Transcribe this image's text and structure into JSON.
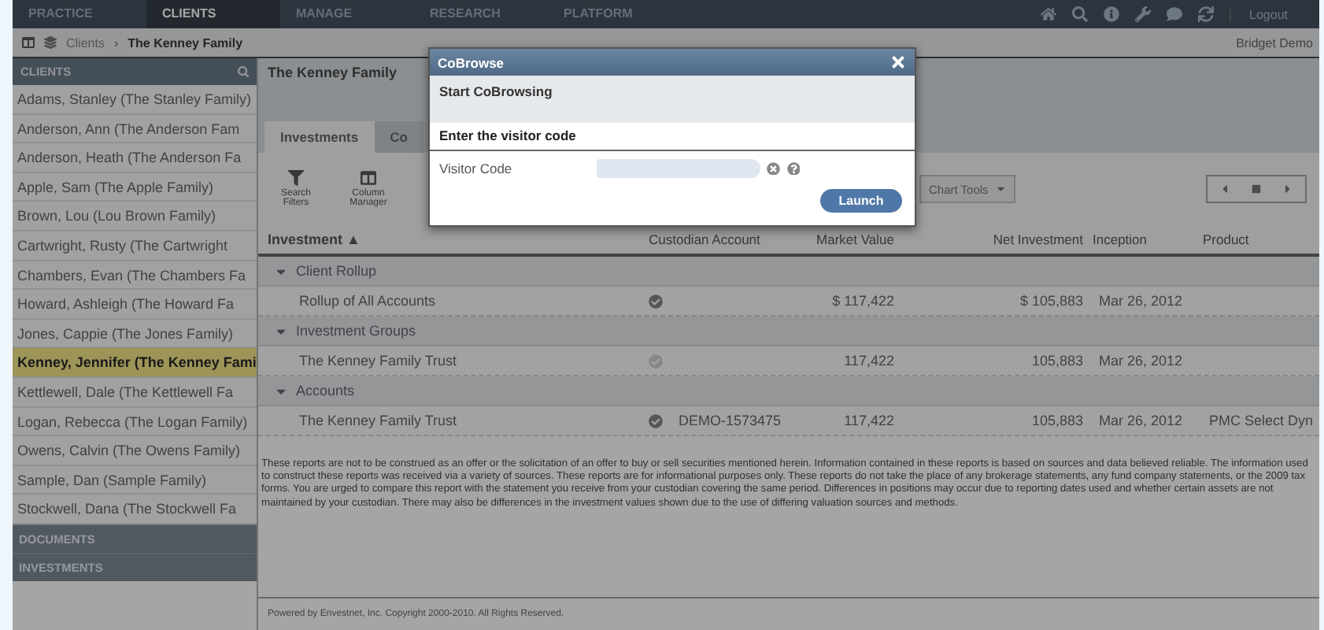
{
  "top_nav": {
    "tabs": [
      {
        "label": "PRACTICE",
        "selected": false
      },
      {
        "label": "CLIENTS",
        "selected": true
      },
      {
        "label": "MANAGE",
        "selected": false
      },
      {
        "label": "RESEARCH",
        "selected": false
      },
      {
        "label": "PLATFORM",
        "selected": false
      }
    ],
    "logout": "Logout"
  },
  "breadcrumb": {
    "items": [
      "Clients",
      "The Kenney Family"
    ],
    "separator": "›",
    "user": "Bridget Demo"
  },
  "sidebar": {
    "title": "CLIENTS",
    "items": [
      {
        "label": "Adams, Stanley (The Stanley Family)",
        "selected": false
      },
      {
        "label": "Anderson, Ann (The Anderson Fam",
        "selected": false
      },
      {
        "label": "Anderson, Heath (The Anderson Fa",
        "selected": false
      },
      {
        "label": "Apple, Sam (The Apple Family)",
        "selected": false
      },
      {
        "label": "Brown, Lou (Lou Brown Family)",
        "selected": false
      },
      {
        "label": "Cartwright, Rusty (The Cartwright",
        "selected": false
      },
      {
        "label": "Chambers, Evan (The Chambers Fa",
        "selected": false
      },
      {
        "label": "Howard, Ashleigh (The Howard Fa",
        "selected": false
      },
      {
        "label": "Jones, Cappie (The Jones Family)",
        "selected": false
      },
      {
        "label": "Kenney, Jennifer (The Kenney Fami",
        "selected": true
      },
      {
        "label": "Kettlewell, Dale (The Kettlewell Fa",
        "selected": false
      },
      {
        "label": "Logan, Rebecca (The Logan Family)",
        "selected": false
      },
      {
        "label": "Owens, Calvin (The Owens Family)",
        "selected": false
      },
      {
        "label": "Sample, Dan (Sample Family)",
        "selected": false
      },
      {
        "label": "Stockwell, Dana (The Stockwell Fa",
        "selected": false
      }
    ],
    "sections": [
      "DOCUMENTS",
      "INVESTMENTS"
    ]
  },
  "content": {
    "title": "The Kenney Family",
    "tabs": [
      {
        "label": "Investments",
        "selected": true
      },
      {
        "label": "Co",
        "selected": false
      }
    ],
    "toolbar": [
      {
        "label": "Search Filters"
      },
      {
        "label": "Column Manager"
      }
    ],
    "dropdown": "Chart Tools",
    "table": {
      "columns": [
        "Investment ▲",
        "Custodian Account",
        "Market Value",
        "Net Investment",
        "Inception",
        "Product"
      ],
      "groups": [
        {
          "label": "Client Rollup",
          "expanded": true,
          "rows": [
            {
              "name": "Rollup of All Accounts",
              "verified": true,
              "account": "",
              "value": "$ 117,422",
              "net": "$ 105,883",
              "inception": "Mar 26, 2012",
              "product": ""
            }
          ]
        },
        {
          "label": "Investment Groups",
          "expanded": true,
          "rows": [
            {
              "name": "The Kenney Family Trust",
              "verified": false,
              "account": "",
              "value": "117,422",
              "net": "105,883",
              "inception": "Mar 26, 2012",
              "product": ""
            }
          ]
        },
        {
          "label": "Accounts",
          "expanded": true,
          "rows": [
            {
              "name": "The Kenney Family Trust",
              "verified": true,
              "account": "DEMO-1573475",
              "value": "117,422",
              "net": "105,883",
              "inception": "Mar 26, 2012",
              "product": "PMC Select Dyn"
            }
          ]
        }
      ]
    },
    "disclaimer": "These reports are not to be construed as an offer or the solicitation of an offer to buy or sell securities mentioned herein. Information contained in these reports is based on sources and data believed reliable. The information used to construct these reports was received via a variety of sources. These reports are for informational purposes only. These reports do not take the place of any brokerage statements, any fund company statements, or the 2009 tax forms. You are urged to compare this report with the statement you receive from your custodian covering the same period. Differences in positions may occur due to reporting dates used and whether certain assets are not maintained by your custodian. There may also be differences in the investment values shown due to the use of differing valuation sources and methods.",
    "footer": "Powered by Envestnet, Inc. Copyright 2000-2010. All Rights Reserved."
  },
  "dialog": {
    "title": "CoBrowse",
    "heading": "Start CoBrowsing",
    "prompt": "Enter the visitor code",
    "field_label": "Visitor Code",
    "button": "Launch"
  }
}
